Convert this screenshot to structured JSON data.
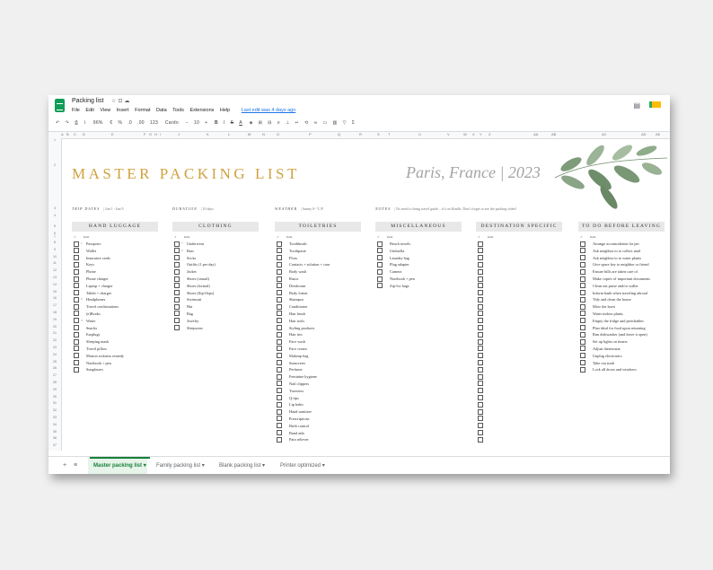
{
  "window": {
    "doc_title": "Packing list",
    "menus": [
      "File",
      "Edit",
      "View",
      "Insert",
      "Format",
      "Data",
      "Tools",
      "Extensions",
      "Help"
    ],
    "last_edit": "Last edit was 4 days ago"
  },
  "toolbar": {
    "zoom": "96%",
    "currency": "€",
    "percent": "%",
    "dec_less": ".0",
    "dec_more": ".00",
    "format": "123",
    "font": "Cardo",
    "font_size": "10",
    "bold": "B",
    "italic": "I",
    "strike": "S",
    "color": "A"
  },
  "columns": [
    "A",
    "B",
    "C",
    "D",
    "E",
    "F",
    "G",
    "H",
    "I",
    "J",
    "K",
    "L",
    "M",
    "N",
    "O",
    "P",
    "Q",
    "R",
    "S",
    "T",
    "U",
    "V",
    "W",
    "X",
    "Y",
    "Z",
    "AA",
    "AB",
    "AC",
    "AD",
    "AE"
  ],
  "rows": [
    "1",
    "2",
    "3",
    "4",
    "5",
    "6",
    "7",
    "8",
    "9",
    "10",
    "11",
    "12",
    "13",
    "14",
    "15",
    "16",
    "17",
    "18",
    "19",
    "20",
    "21",
    "22",
    "23",
    "24",
    "25",
    "26",
    "27",
    "28",
    "29",
    "30",
    "31",
    "32",
    "33",
    "34",
    "35",
    "36",
    "37",
    "38",
    "39",
    "40",
    "41",
    "42"
  ],
  "sheet": {
    "title": "MASTER PACKING LIST",
    "subtitle": "Paris, France | 2023",
    "info": [
      {
        "label": "TRIP DATES",
        "value": "| Jun 1 - Jun 9"
      },
      {
        "label": "DURATION",
        "value": "| 10 days"
      },
      {
        "label": "WEATHER",
        "value": "| Sunny 0- °C/F"
      },
      {
        "label": "NOTES",
        "value": "| No need to bring travel guide – it's on Kindle. Don't forget to see the packing video!"
      }
    ],
    "col_check": "✓",
    "col_item": "Item",
    "categories": [
      {
        "name": "HAND LUGGAGE",
        "items": [
          {
            "n": "1",
            "t": "Passports"
          },
          {
            "n": "",
            "t": "Wallet"
          },
          {
            "n": "",
            "t": "Insurance cards"
          },
          {
            "n": "",
            "t": "Keys"
          },
          {
            "n": "",
            "t": "Phone"
          },
          {
            "n": "",
            "t": "Phone charger"
          },
          {
            "n": "",
            "t": "Laptop + charger"
          },
          {
            "n": "",
            "t": "Tablet + charger"
          },
          {
            "n": "2",
            "t": "Headphones"
          },
          {
            "n": "",
            "t": "Travel confirmations"
          },
          {
            "n": "",
            "t": "(e)Books"
          },
          {
            "n": "3",
            "t": "Water"
          },
          {
            "n": "",
            "t": "Snacks"
          },
          {
            "n": "",
            "t": "Earplugs"
          },
          {
            "n": "",
            "t": "Sleeping mask"
          },
          {
            "n": "",
            "t": "Travel pillow"
          },
          {
            "n": "",
            "t": "Motion sickness remedy"
          },
          {
            "n": "",
            "t": "Notebook + pen"
          },
          {
            "n": "",
            "t": "Sunglasses"
          }
        ]
      },
      {
        "name": "CLOTHING",
        "items": [
          {
            "n": "7",
            "t": "Underwear"
          },
          {
            "n": "2",
            "t": "Bras"
          },
          {
            "n": "",
            "t": "Socks"
          },
          {
            "n": "",
            "t": "Outfits (1 per day)"
          },
          {
            "n": "",
            "t": "Jacket"
          },
          {
            "n": "",
            "t": "Shoes (casual)"
          },
          {
            "n": "",
            "t": "Shoes (formal)"
          },
          {
            "n": "",
            "t": "Shoes (flip-flops)"
          },
          {
            "n": "",
            "t": "Swimsuit"
          },
          {
            "n": "",
            "t": "Hat"
          },
          {
            "n": "",
            "t": "Bag"
          },
          {
            "n": "",
            "t": "Jewelry"
          },
          {
            "n": "",
            "t": "Sleepwear"
          }
        ]
      },
      {
        "name": "TOILETRIES",
        "items": [
          {
            "n": "",
            "t": "Toothbrush"
          },
          {
            "n": "",
            "t": "Toothpaste"
          },
          {
            "n": "",
            "t": "Floss"
          },
          {
            "n": "",
            "t": "Contacts + solution + case"
          },
          {
            "n": "",
            "t": "Body wash"
          },
          {
            "n": "",
            "t": "Razor"
          },
          {
            "n": "",
            "t": "Deodorant"
          },
          {
            "n": "",
            "t": "Body lotion"
          },
          {
            "n": "",
            "t": "Shampoo"
          },
          {
            "n": "",
            "t": "Conditioner"
          },
          {
            "n": "",
            "t": "Hair brush"
          },
          {
            "n": "",
            "t": "Hair tools"
          },
          {
            "n": "",
            "t": "Styling products"
          },
          {
            "n": "",
            "t": "Hair ties"
          },
          {
            "n": "",
            "t": "Face wash"
          },
          {
            "n": "",
            "t": "Face cream"
          },
          {
            "n": "",
            "t": "Makeup bag"
          },
          {
            "n": "",
            "t": "Sunscreen"
          },
          {
            "n": "",
            "t": "Perfume"
          },
          {
            "n": "",
            "t": "Feminine hygiene"
          },
          {
            "n": "",
            "t": "Nail clippers"
          },
          {
            "n": "",
            "t": "Tweezers"
          },
          {
            "n": "",
            "t": "Q-tips"
          },
          {
            "n": "",
            "t": "Lip balm"
          },
          {
            "n": "",
            "t": "Hand sanitizer"
          },
          {
            "n": "",
            "t": "Prescriptions"
          },
          {
            "n": "",
            "t": "Birth control"
          },
          {
            "n": "",
            "t": "Band aids"
          },
          {
            "n": "",
            "t": "Pain reliever"
          }
        ]
      },
      {
        "name": "MISCELLANEOUS",
        "items": [
          {
            "n": "",
            "t": "Beach towels"
          },
          {
            "n": "",
            "t": "Umbrella"
          },
          {
            "n": "",
            "t": "Laundry bag"
          },
          {
            "n": "",
            "t": "Plug adapter"
          },
          {
            "n": "",
            "t": "Camera"
          },
          {
            "n": "",
            "t": "Notebook + pen"
          },
          {
            "n": "",
            "t": "Zip-loc bags"
          }
        ]
      },
      {
        "name": "DESTINATION SPECIFIC",
        "items": [
          {
            "n": "",
            "t": ""
          },
          {
            "n": "",
            "t": ""
          },
          {
            "n": "",
            "t": ""
          },
          {
            "n": "",
            "t": ""
          },
          {
            "n": "",
            "t": ""
          },
          {
            "n": "",
            "t": ""
          },
          {
            "n": "",
            "t": ""
          },
          {
            "n": "",
            "t": ""
          },
          {
            "n": "",
            "t": ""
          },
          {
            "n": "",
            "t": ""
          },
          {
            "n": "",
            "t": ""
          },
          {
            "n": "",
            "t": ""
          },
          {
            "n": "",
            "t": ""
          },
          {
            "n": "",
            "t": ""
          },
          {
            "n": "",
            "t": ""
          },
          {
            "n": "",
            "t": ""
          },
          {
            "n": "",
            "t": ""
          },
          {
            "n": "",
            "t": ""
          },
          {
            "n": "",
            "t": ""
          },
          {
            "n": "",
            "t": ""
          },
          {
            "n": "",
            "t": ""
          },
          {
            "n": "",
            "t": ""
          },
          {
            "n": "",
            "t": ""
          },
          {
            "n": "",
            "t": ""
          },
          {
            "n": "",
            "t": ""
          },
          {
            "n": "",
            "t": ""
          },
          {
            "n": "",
            "t": ""
          },
          {
            "n": "",
            "t": ""
          },
          {
            "n": "",
            "t": ""
          }
        ]
      },
      {
        "name": "TO DO BEFORE LEAVING",
        "items": [
          {
            "n": "",
            "t": "Arrange accomodation for pet"
          },
          {
            "n": "",
            "t": "Ask neighbor to to collect mail"
          },
          {
            "n": "",
            "t": "Ask neighbor to to water plants"
          },
          {
            "n": "",
            "t": "Give spare key to neighbor or friend"
          },
          {
            "n": "",
            "t": "Ensure bills are taken care of"
          },
          {
            "n": "",
            "t": "Make copies of important documents"
          },
          {
            "n": "",
            "t": "Clean out purse and/or wallet"
          },
          {
            "n": "",
            "t": "Inform bank when traveling abroad"
          },
          {
            "n": "",
            "t": "Tidy and clean the house"
          },
          {
            "n": "",
            "t": "Mow the lawn"
          },
          {
            "n": "",
            "t": "Water indoor plants"
          },
          {
            "n": "",
            "t": "Empty the fridge and perishables"
          },
          {
            "n": "",
            "t": "Plan ideal for food upon returning"
          },
          {
            "n": "",
            "t": "Run dishwasher (and leave it open)"
          },
          {
            "n": "",
            "t": "Set up lights on timers"
          },
          {
            "n": "",
            "t": "Adjust thermostat"
          },
          {
            "n": "",
            "t": "Unplug electronics"
          },
          {
            "n": "",
            "t": "Take out trash"
          },
          {
            "n": "",
            "t": "Lock all doors and windows"
          }
        ]
      }
    ]
  },
  "tabs": [
    {
      "label": "Master packing list"
    },
    {
      "label": "Family packing list"
    },
    {
      "label": "Blank packing list"
    },
    {
      "label": "Printer optimized"
    }
  ],
  "tab_add": "+",
  "tab_all": "≡",
  "caret": "▾"
}
